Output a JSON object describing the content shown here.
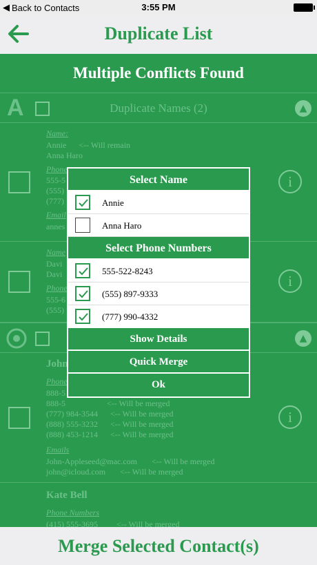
{
  "status": {
    "back": "Back to Contacts",
    "time": "3:55 PM"
  },
  "nav": {
    "title": "Duplicate List"
  },
  "banner": "Multiple Conflicts Found",
  "background": {
    "section1_title": "Duplicate Names (2)",
    "section1_letter": "A",
    "row1": {
      "label": "Name:",
      "line1": "Annie      <-- Will remain",
      "line2": "Anna Haro",
      "phone_label": "Phone",
      "phone1": "555-5",
      "phone2": "(555)",
      "phone3": "(777)",
      "email_label": "Email",
      "email": "annes"
    },
    "row2": {
      "label": "Name",
      "line1": "Davi",
      "line2": "Davi",
      "phone_label": "Phone",
      "phone1": "555-6",
      "phone2": "(555)"
    },
    "row3": {
      "name": "John",
      "phone_label": "Phone",
      "p1": "888-5",
      "p2": "888-5                    <-- Will be merged",
      "p3": "(777) 984-3544      <-- Will be merged",
      "p4": "(888) 555-3232      <-- Will be merged",
      "p5": "(888) 453-1214      <-- Will be merged",
      "email_label": "Emails",
      "e1": "John-Appleseed@mac.com       <-- Will be merged",
      "e2": "john@icloud.com       <-- Will be merged"
    },
    "row4": {
      "name": "Kate Bell",
      "phone_label": "Phone Numbers",
      "p1": "(415) 555-3695         <-- Will be merged"
    }
  },
  "dialog": {
    "name_header": "Select Name",
    "names": [
      {
        "label": "Annie",
        "checked": true
      },
      {
        "label": "Anna Haro",
        "checked": false
      }
    ],
    "phone_header": "Select Phone Numbers",
    "phones": [
      {
        "label": "555-522-8243",
        "checked": true
      },
      {
        "label": "(555) 897-9333",
        "checked": true
      },
      {
        "label": "(777) 990-4332",
        "checked": true
      }
    ],
    "show_details": "Show Details",
    "quick_merge": "Quick Merge",
    "ok": "Ok"
  },
  "merge_button": "Merge Selected Contact(s)",
  "colors": {
    "brand": "#2a9a4f",
    "bar": "#eeeef0"
  }
}
